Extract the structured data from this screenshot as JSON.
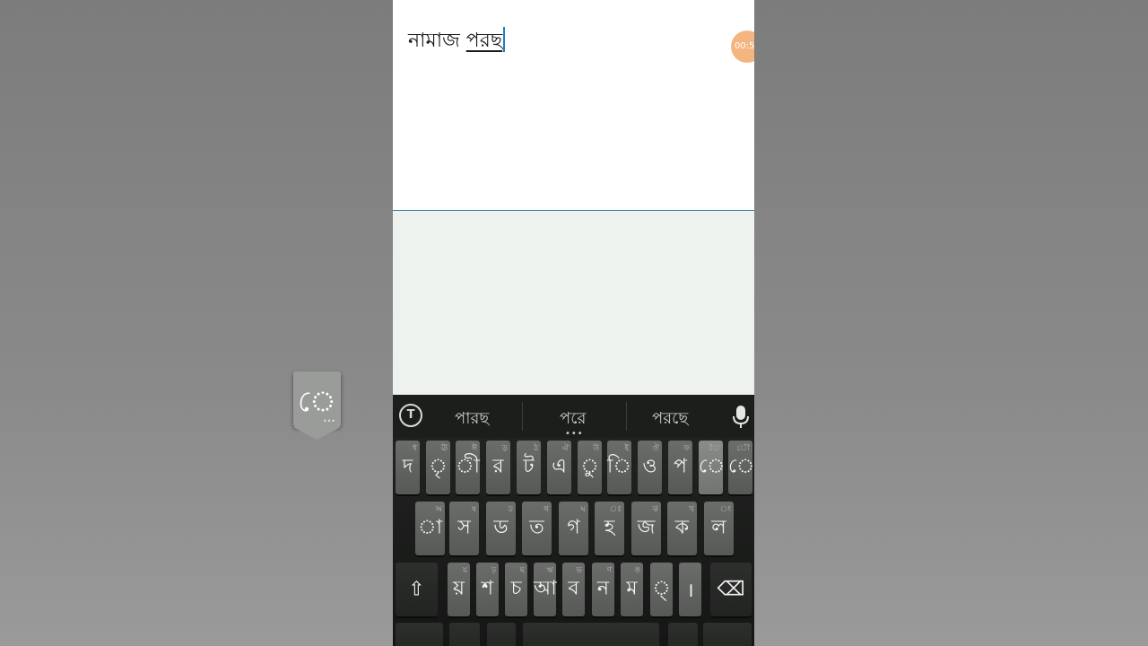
{
  "editor": {
    "committed_text": "নামাজ ",
    "composing_text": "পরছ",
    "timer_badge": "00:5"
  },
  "suggestions": {
    "items": [
      "পারছ",
      "পরে",
      "পরছে"
    ],
    "more_indicator": "•••"
  },
  "popup": {
    "char": "ে",
    "more_indicator": "•••"
  },
  "keyboard": {
    "row1": [
      {
        "main": "দ",
        "hint": "ধ"
      },
      {
        "main": "ৃ",
        "hint": "ঊ"
      },
      {
        "main": "ী",
        "hint": "ঈ"
      },
      {
        "main": "র",
        "hint": "ড়"
      },
      {
        "main": "ট",
        "hint": "ঠ"
      },
      {
        "main": "এ",
        "hint": "ঐ"
      },
      {
        "main": "ু",
        "hint": "উ"
      },
      {
        "main": "ি",
        "hint": "ই"
      },
      {
        "main": "ও",
        "hint": "ঔ"
      },
      {
        "main": "প",
        "hint": "ফ"
      },
      {
        "main": "ে",
        "hint": "ৈ"
      },
      {
        "main": "ো",
        "hint": "ৌ"
      }
    ],
    "row2": [
      {
        "main": "া",
        "hint": "অ"
      },
      {
        "main": "স",
        "hint": "ষ"
      },
      {
        "main": "ড",
        "hint": "ঢ"
      },
      {
        "main": "ত",
        "hint": "থ"
      },
      {
        "main": "গ",
        "hint": "ঘ"
      },
      {
        "main": "হ",
        "hint": "ঃ"
      },
      {
        "main": "জ",
        "hint": "ঝ"
      },
      {
        "main": "ক",
        "hint": "খ"
      },
      {
        "main": "ল",
        "hint": "ং"
      }
    ],
    "row3": [
      {
        "main": "য়",
        "hint": "য"
      },
      {
        "main": "শ",
        "hint": "ঢ়"
      },
      {
        "main": "চ",
        "hint": "ছ"
      },
      {
        "main": "আ",
        "hint": "ঋ"
      },
      {
        "main": "ব",
        "hint": "ভ"
      },
      {
        "main": "ন",
        "hint": "ণ"
      },
      {
        "main": "ম",
        "hint": "ঙ"
      },
      {
        "main": "্",
        "hint": ""
      },
      {
        "main": "।",
        "hint": ""
      }
    ],
    "shift_label": "⇧",
    "backspace_label": "⌫"
  },
  "icons": {
    "theme": "transliteration-toggle-icon",
    "mic": "microphone-icon",
    "shift": "shift-icon",
    "backspace": "backspace-icon"
  },
  "colors": {
    "cursor": "#1e7fc0",
    "divider": "#2f7f9e",
    "badge": "#f5b27a"
  }
}
